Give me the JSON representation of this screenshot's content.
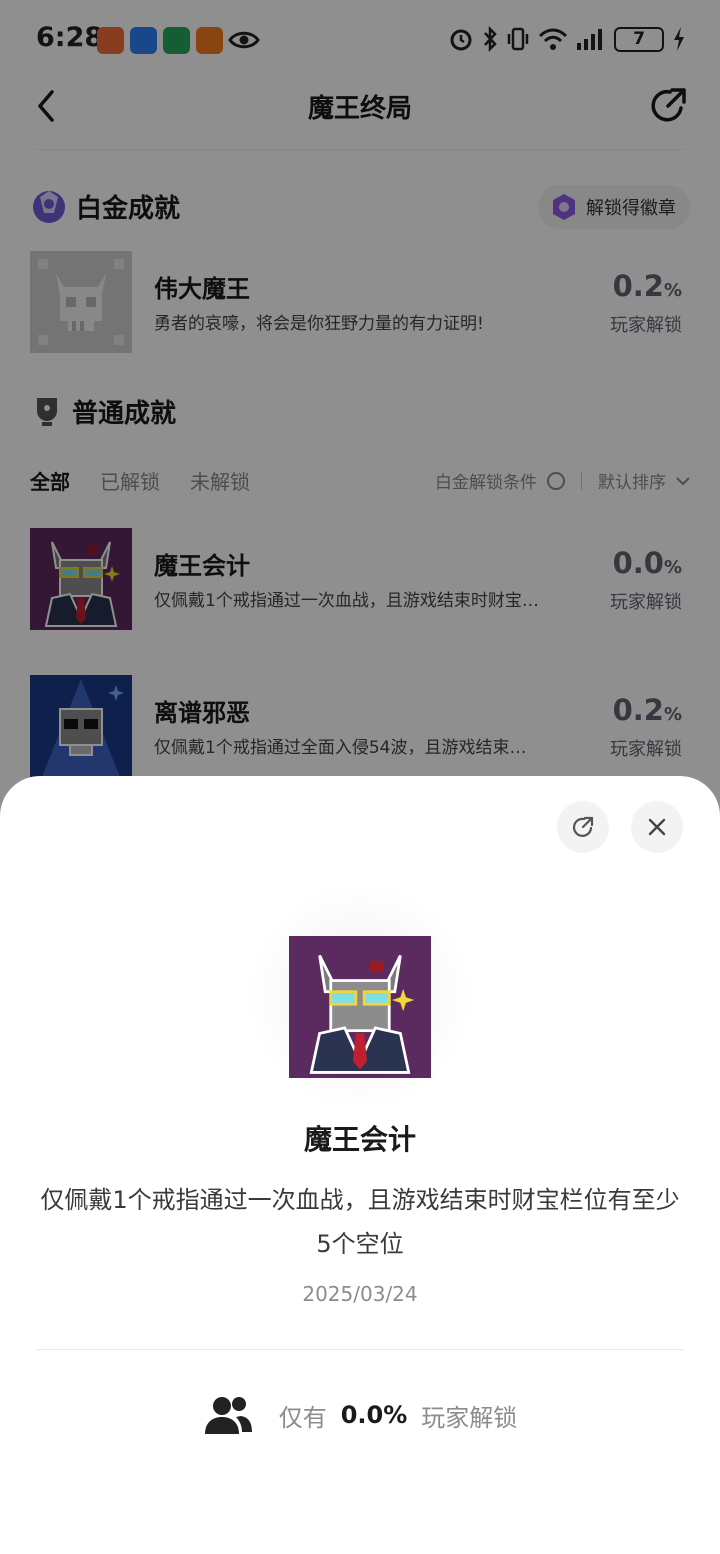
{
  "status_bar": {
    "time": "6:28",
    "battery": "7"
  },
  "nav": {
    "title": "魔王终局"
  },
  "platinum": {
    "section_title": "白金成就",
    "badge_label": "解锁得徽章",
    "item": {
      "name": "伟大魔王",
      "desc": "勇者的哀嚎，将会是你狂野力量的有力证明!",
      "pct": "0.2",
      "pct_unit": "%",
      "pct_label": "玩家解锁"
    }
  },
  "normal": {
    "section_title": "普通成就",
    "tabs": [
      "全部",
      "已解锁",
      "未解锁"
    ],
    "platinum_condition": "白金解锁条件",
    "sort_label": "默认排序",
    "items": [
      {
        "name": "魔王会计",
        "desc": "仅佩戴1个戒指通过一次血战，且游戏结束时财宝…",
        "pct": "0.0",
        "pct_unit": "%",
        "pct_label": "玩家解锁"
      },
      {
        "name": "离谱邪恶",
        "desc": "仅佩戴1个戒指通过全面入侵54波，且游戏结束…",
        "pct": "0.2",
        "pct_unit": "%",
        "pct_label": "玩家解锁"
      }
    ]
  },
  "sheet": {
    "title": "魔王会计",
    "desc": "仅佩戴1个戒指通过一次血战，且游戏结束时财宝栏位有至少5个空位",
    "date": "2025/03/24",
    "stat_prefix": "仅有",
    "stat_pct": "0.0%",
    "stat_suffix": "玩家解锁"
  },
  "colors": {
    "overlay": "#000000",
    "pixel_purple": "#5b2a5e",
    "pixel_blue": "#1e3a8a",
    "text_gray": "#5f6570"
  }
}
